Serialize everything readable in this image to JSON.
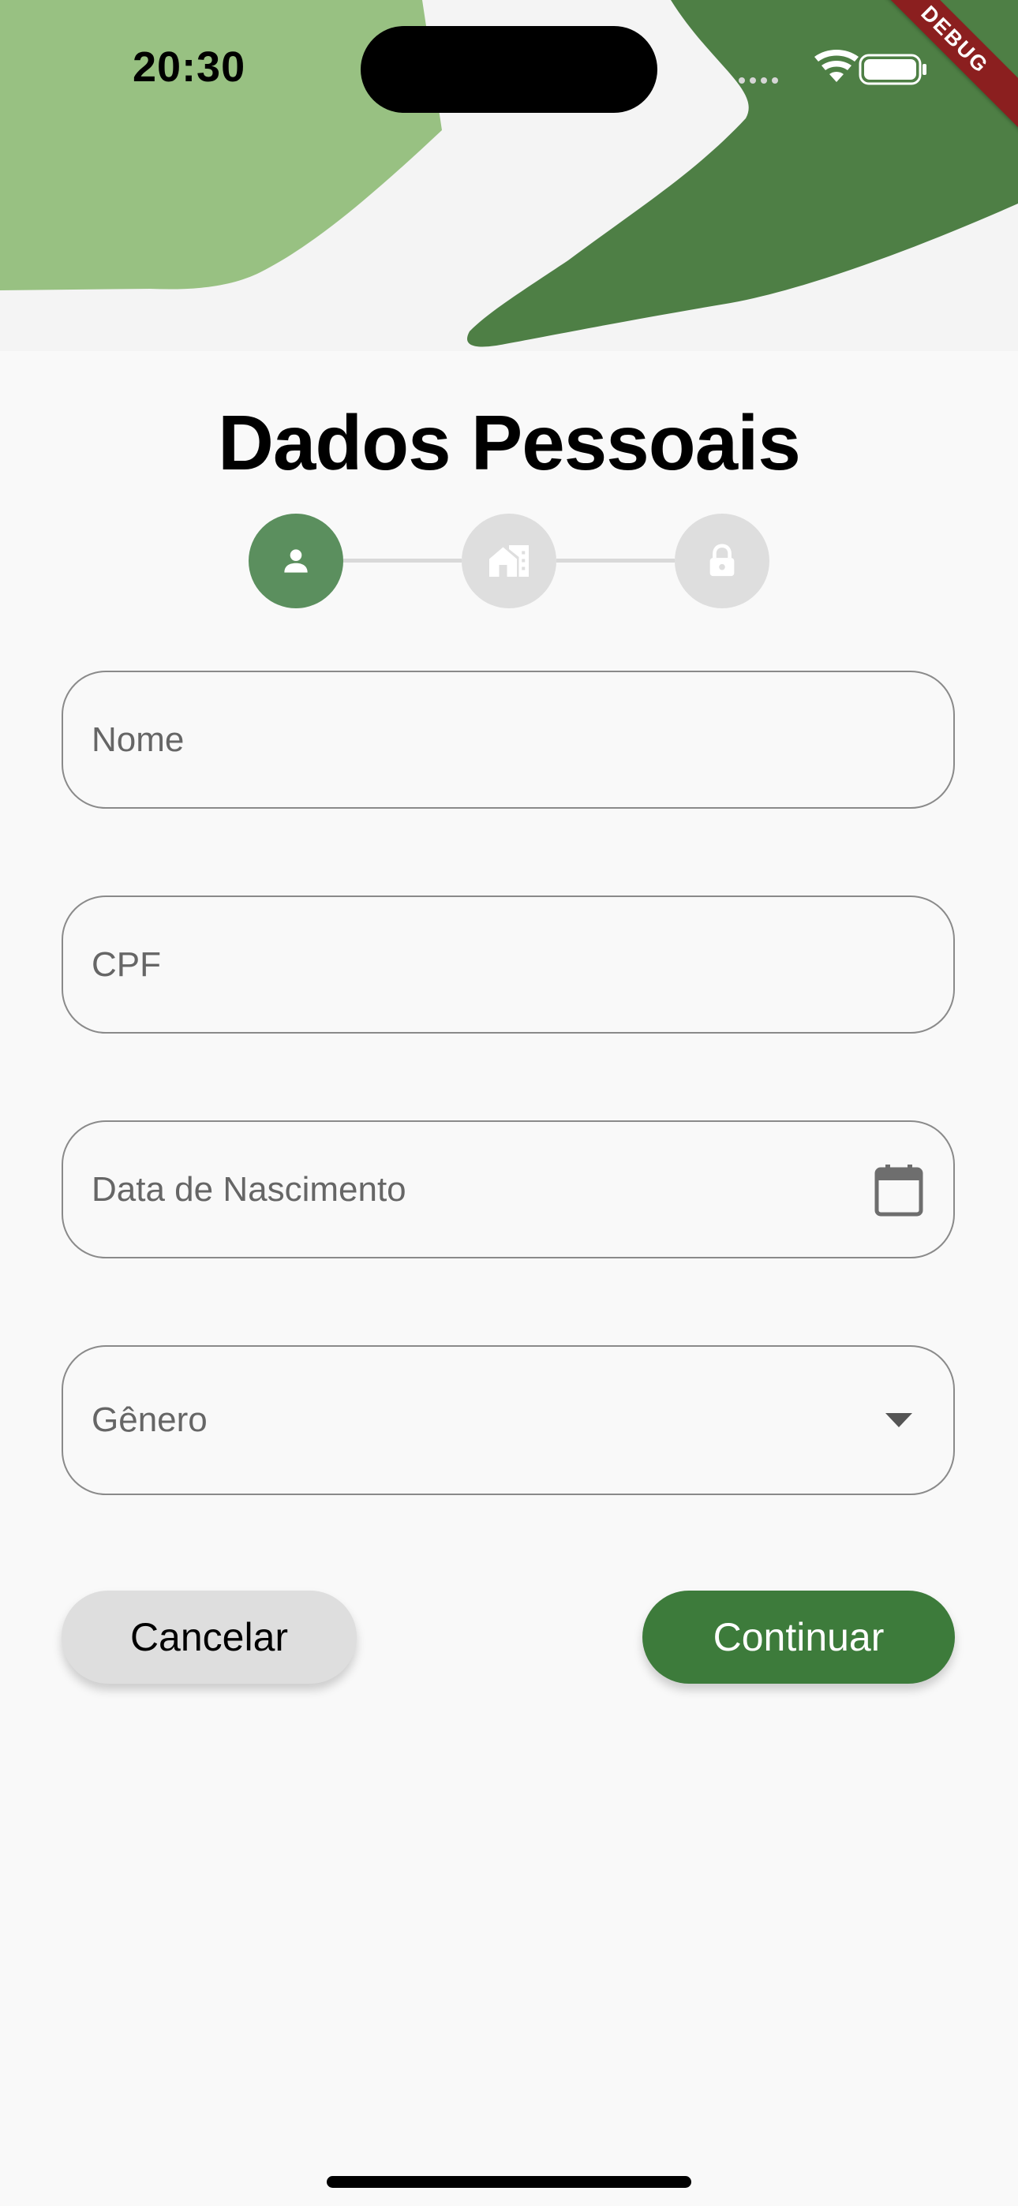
{
  "status_bar": {
    "time": "20:30",
    "icons": [
      "cellular-icon",
      "wifi-icon",
      "battery-icon"
    ]
  },
  "debug_banner": "DEBUG",
  "title": "Dados Pessoais",
  "stepper": {
    "steps": [
      {
        "icon": "person-icon",
        "active": true
      },
      {
        "icon": "house-icon",
        "active": false
      },
      {
        "icon": "lock-icon",
        "active": false
      }
    ]
  },
  "form": {
    "nome": {
      "label": "Nome",
      "value": ""
    },
    "cpf": {
      "label": "CPF",
      "value": ""
    },
    "data_nascimento": {
      "label": "Data de Nascimento",
      "value": "",
      "icon": "calendar-icon"
    },
    "genero": {
      "label": "Gênero",
      "value": "",
      "icon": "dropdown-arrow-icon"
    }
  },
  "buttons": {
    "cancel_label": "Cancelar",
    "continue_label": "Continuar"
  },
  "colors": {
    "accent": "#3d7b3b",
    "step_active": "#5b8f5e",
    "step_inactive": "#dedede",
    "blob_light": "#98c182",
    "blob_dark": "#4e7f45",
    "debug": "#8b1f1f"
  }
}
